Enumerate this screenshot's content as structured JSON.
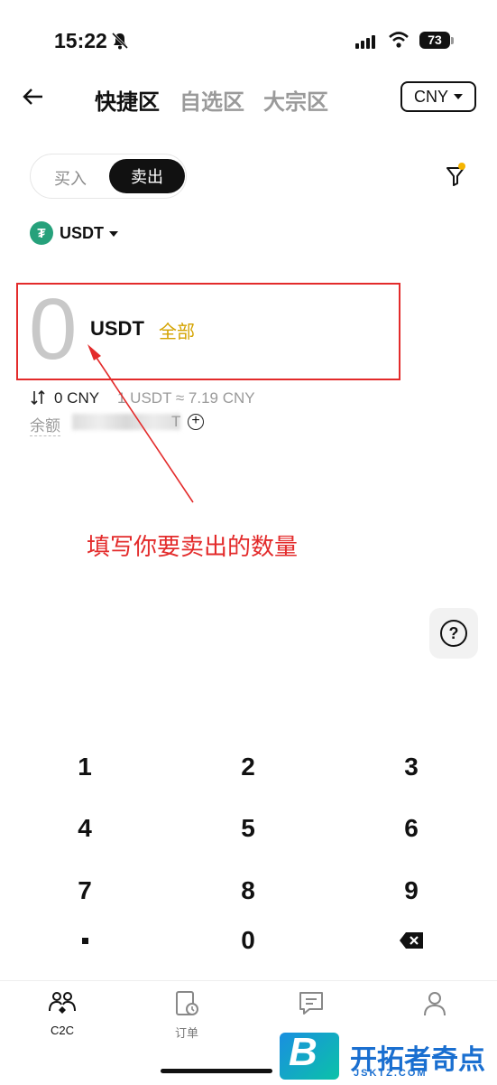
{
  "status_bar": {
    "time": "15:22",
    "battery": "73"
  },
  "header": {
    "tabs": [
      {
        "label": "快捷区",
        "active": true
      },
      {
        "label": "自选区",
        "active": false
      },
      {
        "label": "大宗区",
        "active": false
      }
    ],
    "currency": "CNY"
  },
  "trade_toggle": {
    "buy_label": "买入",
    "sell_label": "卖出",
    "selected": "sell"
  },
  "coin_select": {
    "label": "USDT",
    "icon": "tether-icon"
  },
  "amount": {
    "value": "0",
    "unit": "USDT",
    "all_label": "全部"
  },
  "conversion": {
    "amount_text": "0 CNY",
    "rate_text": "1 USDT ≈ 7.19 CNY"
  },
  "balance": {
    "label": "余额",
    "suffix": "T"
  },
  "annotation": {
    "text": "填写你要卖出的数量"
  },
  "keypad": {
    "keys": [
      "1",
      "2",
      "3",
      "4",
      "5",
      "6",
      "7",
      "8",
      "9",
      "·",
      "0",
      "⌫"
    ]
  },
  "bottom_nav": {
    "items": [
      {
        "label": "C2C",
        "icon": "c2c-icon",
        "active": true
      },
      {
        "label": "订单",
        "icon": "order-icon",
        "active": false
      },
      {
        "label": "",
        "icon": "chat-icon",
        "active": false
      },
      {
        "label": "",
        "icon": "profile-icon",
        "active": false
      }
    ]
  },
  "watermark": {
    "letter": "B",
    "title": "开拓者奇点",
    "subtitle": "JSKTZ.COM"
  },
  "colors": {
    "accent_gold": "#d4a300",
    "annotation_red": "#e32b2b",
    "tether_green": "#26a17b"
  }
}
